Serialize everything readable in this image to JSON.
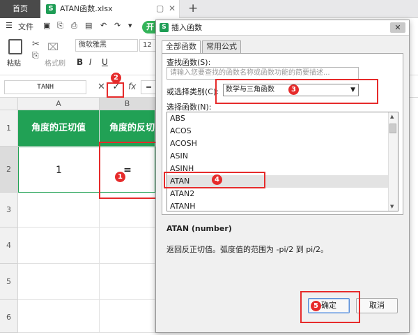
{
  "tabs": {
    "home": "首页",
    "file": "ATAN函数.xlsx",
    "new": "+",
    "file_badge": "S"
  },
  "menu": {
    "file": "文件",
    "kai": "开"
  },
  "ribbon": {
    "paste": "粘贴",
    "format_painter": "格式刷",
    "font": "微软雅黑",
    "size": "12"
  },
  "formula_bar": {
    "namebox": "TANH",
    "cancel": "✕",
    "confirm": "✓",
    "fx": "fx",
    "content": "="
  },
  "sheet": {
    "columns": [
      "A",
      "B"
    ],
    "rows": [
      "1",
      "2",
      "3",
      "4",
      "5",
      "6"
    ],
    "A1": "角度的正切值",
    "B1": "角度的反切",
    "A2": "1",
    "B2": "="
  },
  "dialog": {
    "title": "插入函数",
    "tab_all": "全部函数",
    "tab_common": "常用公式",
    "search_label": "查找函数(S):",
    "search_placeholder": "请输入您要查找的函数名称或函数功能的简要描述...",
    "category_label": "或选择类别(C):",
    "category_value": "数学与三角函数",
    "select_label": "选择函数(N):",
    "functions": [
      "ABS",
      "ACOS",
      "ACOSH",
      "ASIN",
      "ASINH",
      "ATAN",
      "ATAN2",
      "ATANH"
    ],
    "selected": "ATAN",
    "syntax": "ATAN (number)",
    "description": "返回反正切值。弧度值的范围为 -pi/2 到 pi/2。",
    "ok": "确定",
    "cancel": "取消"
  },
  "markers": [
    "1",
    "2",
    "3",
    "4",
    "5"
  ],
  "colors": {
    "header_green": "#21a155",
    "annotation_red": "#e62b2b"
  }
}
